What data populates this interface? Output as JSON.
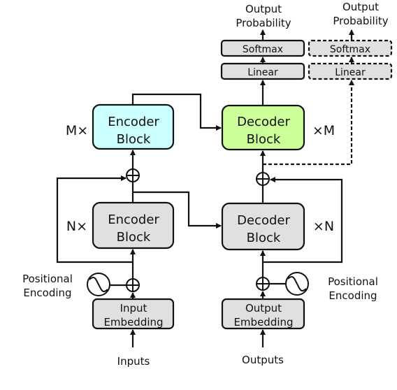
{
  "colors": {
    "encoder_top": "#ccffff",
    "decoder_top": "#ccff99",
    "block": "#e0e0e0",
    "line": "#111111"
  },
  "output_left": {
    "line1": "Output",
    "line2": "Probability",
    "softmax": "Softmax",
    "linear": "Linear"
  },
  "output_right": {
    "line1": "Output",
    "line2": "Probability",
    "softmax": "Softmax",
    "linear": "Linear",
    "style": "dashed"
  },
  "encoder_top": {
    "line1": "Encoder",
    "line2": "Block",
    "repeat": "M×"
  },
  "decoder_top": {
    "line1": "Decoder",
    "line2": "Block",
    "repeat": "×M"
  },
  "encoder": {
    "line1": "Encoder",
    "line2": "Block",
    "repeat": "N×"
  },
  "decoder": {
    "line1": "Decoder",
    "line2": "Block",
    "repeat": "×N"
  },
  "input_embedding": {
    "line1": "Input",
    "line2": "Embedding"
  },
  "output_embedding": {
    "line1": "Output",
    "line2": "Embedding"
  },
  "pos_left": {
    "line1": "Positional",
    "line2": "Encoding",
    "icon": "sine-wave-icon"
  },
  "pos_right": {
    "line1": "Positional",
    "line2": "Encoding",
    "icon": "sine-wave-icon"
  },
  "inputs": "Inputs",
  "outputs": "Outputs"
}
